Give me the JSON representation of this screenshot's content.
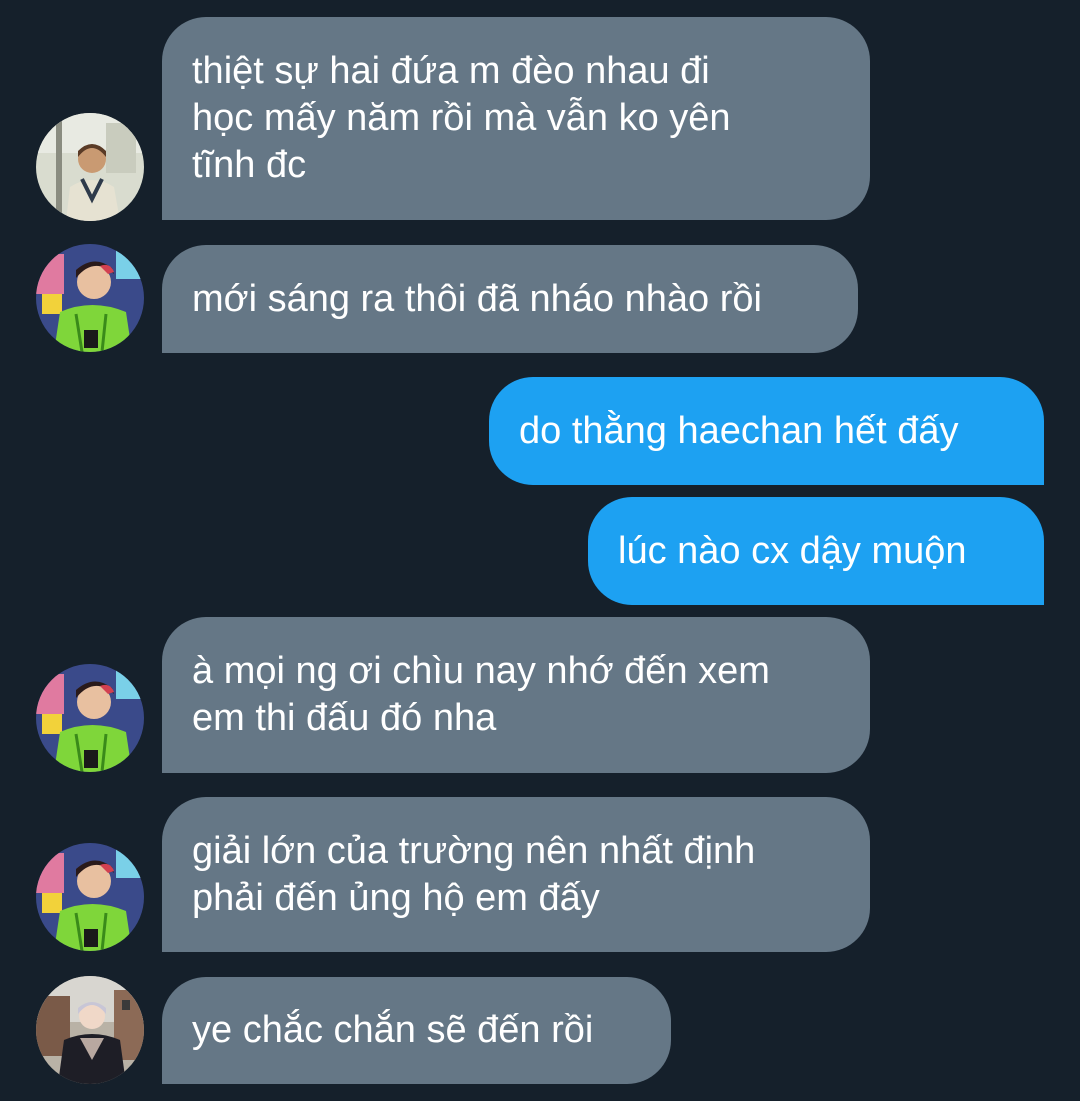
{
  "conversation": {
    "messages": [
      {
        "side": "received",
        "avatar": "boy-in-sweater-avatar",
        "text": "thiệt sự hai đứa m đèo nhau đi\nhọc mấy năm rồi mà vẫn ko yên\ntĩnh đc"
      },
      {
        "side": "received",
        "avatar": "green-jacket-avatar",
        "text": "mới sáng ra thôi đã nháo nhào rồi"
      },
      {
        "side": "sent",
        "text": "do thằng haechan hết đấy"
      },
      {
        "side": "sent",
        "text": "lúc nào cx dậy muộn"
      },
      {
        "side": "received",
        "avatar": "green-jacket-avatar",
        "text": "à mọi ng ơi chìu nay nhớ đến xem\nem thi đấu đó nha"
      },
      {
        "side": "received",
        "avatar": "green-jacket-avatar",
        "text": "giải lớn của trường nên nhất định\nphải đến ủng hộ em đấy"
      },
      {
        "side": "received",
        "avatar": "black-jacket-avatar",
        "text": "ye chắc chắn sẽ đến rồi"
      }
    ]
  },
  "colors": {
    "background": "#15202b",
    "received_bubble": "#657786",
    "sent_bubble": "#1da1f2",
    "text": "#ffffff"
  }
}
